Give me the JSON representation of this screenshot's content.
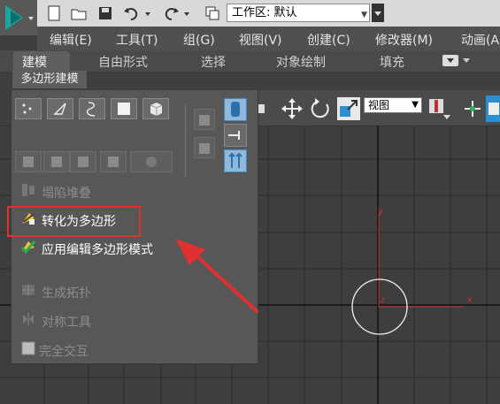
{
  "workspace": {
    "label": "工作区: 默认"
  },
  "menu": [
    "编辑(E)",
    "工具(T)",
    "组(G)",
    "视图(V)",
    "创建(C)",
    "修改器(M)",
    "动画(A"
  ],
  "ribbon": {
    "tabs": [
      "建模",
      "自由形式",
      "选择",
      "对象绘制",
      "填充"
    ],
    "active_tab": "建模"
  },
  "subtab": "多边形建模",
  "viewport": {
    "view_select": "视图",
    "axis_x": "x",
    "axis_y": "y",
    "origin": "z"
  },
  "panel": {
    "items": [
      {
        "label": "塌陷堆叠",
        "enabled": false
      },
      {
        "label": "转化为多边形",
        "enabled": true,
        "highlighted": true
      },
      {
        "label": "应用编辑多边形模式",
        "enabled": true
      },
      {
        "label": "生成拓扑",
        "enabled": false
      },
      {
        "label": "对称工具",
        "enabled": false
      },
      {
        "label": "完全交互",
        "enabled": false
      }
    ]
  },
  "colors": {
    "highlight": "#e03030",
    "arrow": "#e03030",
    "accent": "#2d8fd0"
  }
}
